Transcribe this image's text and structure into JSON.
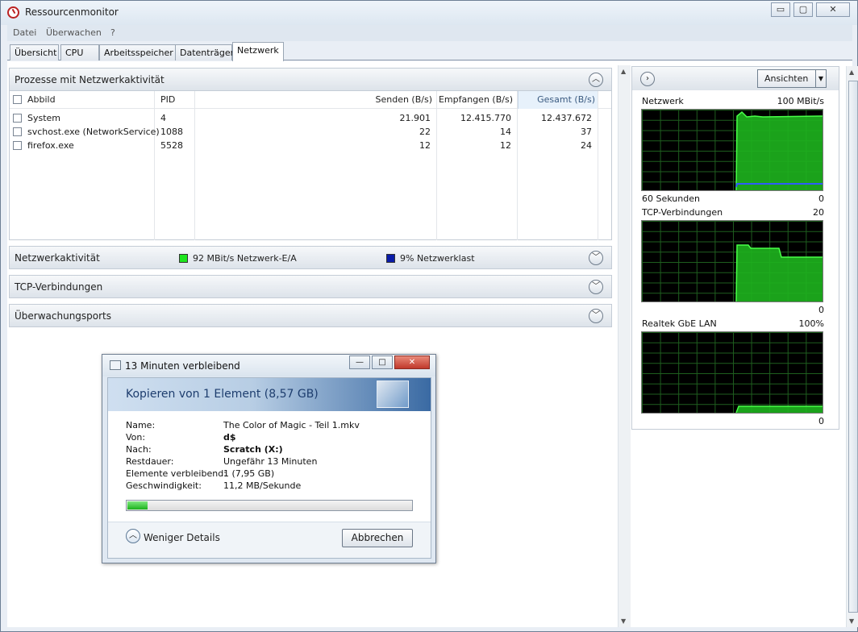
{
  "window": {
    "title": "Ressourcenmonitor",
    "minimize_label": "▭",
    "maximize_label": "▢",
    "close_label": "✕"
  },
  "menu": [
    "Datei",
    "Überwachen",
    "?"
  ],
  "tabs": [
    "Übersicht",
    "CPU",
    "Arbeitsspeicher",
    "Datenträger",
    "Netzwerk"
  ],
  "active_tab": "Netzwerk",
  "processes_section": {
    "title": "Prozesse mit Netzwerkaktivität",
    "columns": [
      "Abbild",
      "PID",
      "Senden (B/s)",
      "Empfangen (B/s)",
      "Gesamt (B/s)"
    ],
    "rows": [
      {
        "name": "System",
        "pid": "4",
        "send": "21.901",
        "receive": "12.415.770",
        "total": "12.437.672"
      },
      {
        "name": "svchost.exe (NetworkService)",
        "pid": "1088",
        "send": "22",
        "receive": "14",
        "total": "37"
      },
      {
        "name": "firefox.exe",
        "pid": "5528",
        "send": "12",
        "receive": "12",
        "total": "24"
      }
    ]
  },
  "network_activity_section": {
    "title": "Netzwerkaktivität",
    "legend": [
      {
        "color": "#1ee51e",
        "text": "92 MBit/s Netzwerk-E/A"
      },
      {
        "color": "#0a1ca8",
        "text": "9% Netzwerklast"
      }
    ]
  },
  "tcp_section": {
    "title": "TCP-Verbindungen"
  },
  "ports_section": {
    "title": "Überwachungsports"
  },
  "right_panel": {
    "views_button": "Ansichten",
    "graphs": [
      {
        "title": "Netzwerk",
        "max": "100 MBit/s",
        "bottom_left": "60 Sekunden",
        "bottom_right": "0"
      },
      {
        "title": "TCP-Verbindungen",
        "max": "20",
        "bottom_left": "",
        "bottom_right": "0"
      },
      {
        "title": "Realtek GbE LAN",
        "max": "100%",
        "bottom_left": "",
        "bottom_right": "0"
      }
    ]
  },
  "copy_dialog": {
    "title": "13 Minuten verbleibend",
    "heading": "Kopieren von 1 Element (8,57 GB)",
    "details": [
      {
        "label": "Name:",
        "value": "The Color of Magic - Teil 1.mkv",
        "bold": false
      },
      {
        "label": "Von:",
        "value": "d$",
        "bold": true
      },
      {
        "label": "Nach:",
        "value": "Scratch (X:)",
        "bold": true
      },
      {
        "label": "Restdauer:",
        "value": "Ungefähr 13 Minuten",
        "bold": false
      },
      {
        "label": "Elemente verbleibend:",
        "value": "1 (7,95 GB)",
        "bold": false
      },
      {
        "label": "Geschwindigkeit:",
        "value": "11,2 MB/Sekunde",
        "bold": false
      }
    ],
    "progress_fraction": 0.07,
    "fewer_details_label": "Weniger Details",
    "cancel_label": "Abbrechen"
  }
}
